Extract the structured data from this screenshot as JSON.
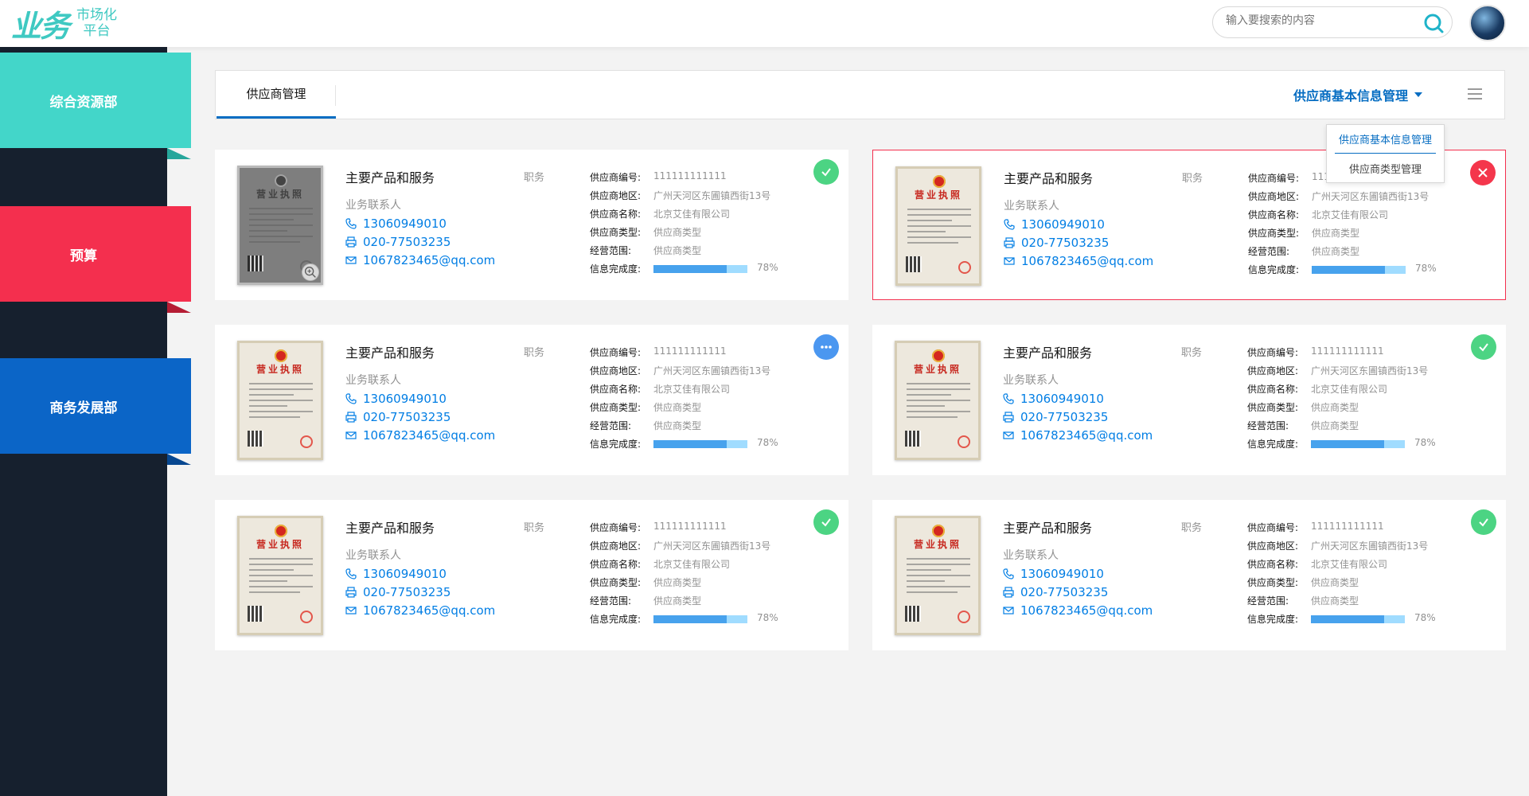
{
  "header": {
    "logo_text": "业务",
    "logo_sub1": "市场化",
    "logo_sub2": "平台",
    "search_placeholder": "输入要搜索的内容"
  },
  "sidebar": {
    "items": [
      {
        "label": "综合资源部",
        "color": "#43d6c9"
      },
      {
        "label": "预算",
        "color": "#f42f4e"
      },
      {
        "label": "商务发展部",
        "color": "#0b65c7"
      }
    ]
  },
  "tabs": {
    "active_tab": "供应商管理",
    "dropdown_label": "供应商基本信息管理",
    "dropdown_menu": [
      "供应商基本信息管理",
      "供应商类型管理"
    ]
  },
  "labels": {
    "product": "主要产品和服务",
    "job": "职务",
    "contact_person": "业务联系人",
    "license_title": "营业执照",
    "supplier_no": "供应商编号:",
    "supplier_region": "供应商地区:",
    "supplier_name": "供应商名称:",
    "supplier_type": "供应商类型:",
    "business_scope": "经营范围:",
    "completeness": "信息完成度:"
  },
  "colors": {
    "primary": "#066dc2",
    "link": "#027ee4",
    "muted": "#919191",
    "progress_fill": "#47a2ed",
    "progress_track": "#a0dcff",
    "delete_border": "#f42f4e"
  },
  "cards": [
    {
      "phone": "13060949010",
      "fax": "020-77503235",
      "email": "1067823465@qq.com",
      "supplier_no": "111111111111",
      "region": "广州天河区东圃镇西街13号",
      "name": "北京艾佳有限公司",
      "type": "供应商类型",
      "scope": "供应商类型",
      "pct_text": "78%",
      "progress": 0.78,
      "status": "ok",
      "gray": true
    },
    {
      "phone": "13060949010",
      "fax": "020-77503235",
      "email": "1067823465@qq.com",
      "supplier_no": "111111111111",
      "region": "广州天河区东圃镇西街13号",
      "name": "北京艾佳有限公司",
      "type": "供应商类型",
      "scope": "供应商类型",
      "pct_text": "78%",
      "progress": 0.78,
      "status": "del",
      "gray": false
    },
    {
      "phone": "13060949010",
      "fax": "020-77503235",
      "email": "1067823465@qq.com",
      "supplier_no": "111111111111",
      "region": "广州天河区东圃镇西街13号",
      "name": "北京艾佳有限公司",
      "type": "供应商类型",
      "scope": "供应商类型",
      "pct_text": "78%",
      "progress": 0.78,
      "status": "edit",
      "gray": false
    },
    {
      "phone": "13060949010",
      "fax": "020-77503235",
      "email": "1067823465@qq.com",
      "supplier_no": "111111111111",
      "region": "广州天河区东圃镇西街13号",
      "name": "北京艾佳有限公司",
      "type": "供应商类型",
      "scope": "供应商类型",
      "pct_text": "78%",
      "progress": 0.78,
      "status": "ok",
      "gray": false
    },
    {
      "phone": "13060949010",
      "fax": "020-77503235",
      "email": "1067823465@qq.com",
      "supplier_no": "111111111111",
      "region": "广州天河区东圃镇西街13号",
      "name": "北京艾佳有限公司",
      "type": "供应商类型",
      "scope": "供应商类型",
      "pct_text": "78%",
      "progress": 0.78,
      "status": "ok",
      "gray": false
    },
    {
      "phone": "13060949010",
      "fax": "020-77503235",
      "email": "1067823465@qq.com",
      "supplier_no": "111111111111",
      "region": "广州天河区东圃镇西街13号",
      "name": "北京艾佳有限公司",
      "type": "供应商类型",
      "scope": "供应商类型",
      "pct_text": "78%",
      "progress": 0.78,
      "status": "ok",
      "gray": false
    }
  ]
}
